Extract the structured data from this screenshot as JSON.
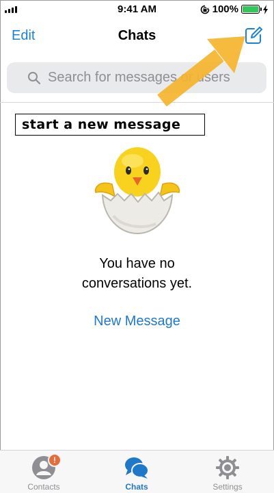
{
  "status_bar": {
    "time": "9:41 AM",
    "battery_percent": "100%",
    "battery_level": 1.0,
    "battery_color": "#33c759"
  },
  "nav": {
    "edit_label": "Edit",
    "title": "Chats",
    "compose_icon": "compose-icon"
  },
  "search": {
    "placeholder": "Search for messages or users"
  },
  "annotation": {
    "label": "start a new message",
    "arrow_color": "#f5b52e"
  },
  "empty_state": {
    "image": "hatching-chick-icon",
    "line1": "You have no",
    "line2": "conversations yet.",
    "action_label": "New Message"
  },
  "tabs": [
    {
      "label": "Contacts",
      "icon": "person-icon",
      "badge": "!",
      "active": false
    },
    {
      "label": "Chats",
      "icon": "chat-bubbles-icon",
      "active": true
    },
    {
      "label": "Settings",
      "icon": "gear-icon",
      "active": false
    }
  ],
  "colors": {
    "accent": "#1a82d6",
    "badge": "#e86b3a",
    "inactive": "#8e8e93"
  }
}
